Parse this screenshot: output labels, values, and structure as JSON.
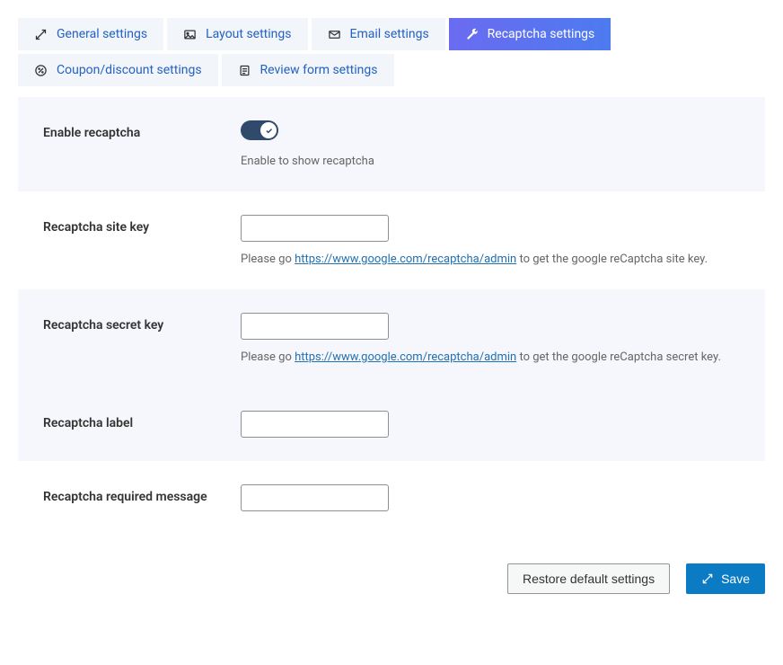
{
  "tabs": {
    "general": {
      "label": "General settings"
    },
    "layout": {
      "label": "Layout settings"
    },
    "email": {
      "label": "Email settings"
    },
    "recaptcha": {
      "label": "Recaptcha settings"
    },
    "coupon": {
      "label": "Coupon/discount settings"
    },
    "review": {
      "label": "Review form settings"
    }
  },
  "fields": {
    "enable": {
      "label": "Enable recaptcha",
      "toggled": true,
      "help": "Enable to show recaptcha"
    },
    "siteKey": {
      "label": "Recaptcha site key",
      "value": "",
      "help_pre": "Please go ",
      "help_link_text": "https://www.google.com/recaptcha/admin",
      "help_link_href": "https://www.google.com/recaptcha/admin",
      "help_post": " to get the google reCaptcha site key."
    },
    "secretKey": {
      "label": "Recaptcha secret key",
      "value": "",
      "help_pre": "Please go ",
      "help_link_text": "https://www.google.com/recaptcha/admin",
      "help_link_href": "https://www.google.com/recaptcha/admin",
      "help_post": " to get the google reCaptcha secret key."
    },
    "captchaLabel": {
      "label": "Recaptcha label",
      "value": ""
    },
    "requiredMsg": {
      "label": "Recaptcha required message",
      "value": ""
    }
  },
  "footer": {
    "restore": "Restore default settings",
    "save": "Save"
  }
}
